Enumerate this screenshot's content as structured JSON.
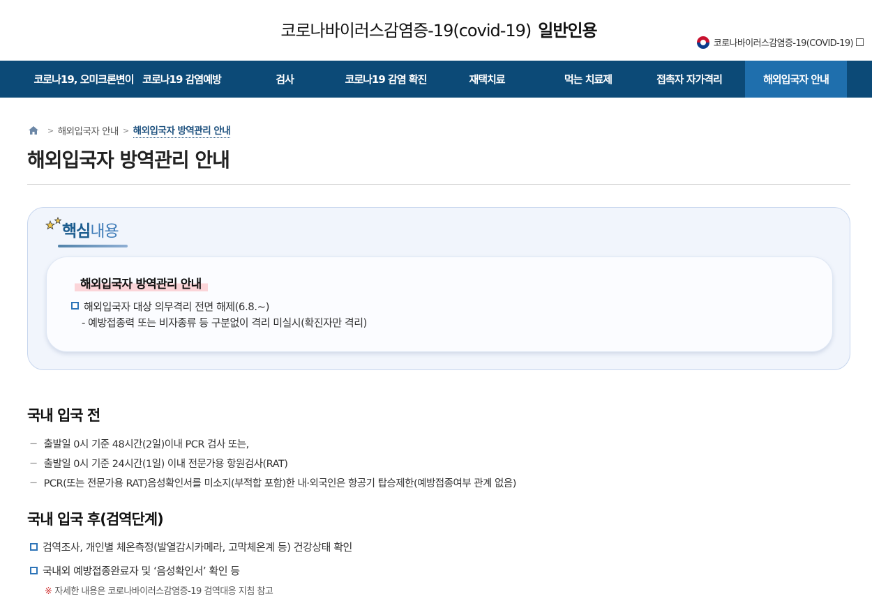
{
  "header": {
    "title_part1": "코로나바이러스감염증-19(covid-19)",
    "title_part2": "일반인용",
    "ministry_label": "코로나바이러스감염증-19(COVID-19)",
    "ministry_icon": "taegukgi-icon",
    "ext_icon": "external-link-icon"
  },
  "nav": {
    "items": [
      "코로나19, 오미크론변이",
      "코로나19 감염예방",
      "검사",
      "코로나19 감염 확진",
      "재택치료",
      "먹는 치료제",
      "접촉자 자가격리",
      "해외입국자 안내"
    ],
    "active_index": 7,
    "colors": {
      "bar": "#0c4a77",
      "active": "#1f6fad"
    }
  },
  "breadcrumb": {
    "home_icon": "home-icon",
    "items": [
      "해외입국자 안내",
      "해외입국자 방역관리 안내"
    ]
  },
  "page_title": "해외입국자 방역관리 안내",
  "key_box": {
    "label_bold": "핵심",
    "label_light": "내용",
    "title": "해외입국자 방역관리 안내",
    "line1": "해외입국자 대상 의무격리 전면 해제(6.8.~)",
    "line2": "- 예방접종력 또는 비자종류 등 구분없이 격리 미실시(확진자만 격리)"
  },
  "section1": {
    "title": "국내 입국 전",
    "items": [
      "출발일 0시 기준 48시간(2일)이내 PCR 검사 또는,",
      "출발일 0시 기준 24시간(1일) 이내 전문가용 항원검사(RAT)",
      "PCR(또는 전문가용 RAT)음성확인서를 미소지(부적합 포함)한 내·외국인은 항공기 탑승제한(예방접종여부 관계 없음)"
    ]
  },
  "section2": {
    "title": "국내 입국 후(검역단계)",
    "items": [
      "검역조사, 개인별 체온측정(발열감시카메라, 고막체온계 등) 건강상태 확인",
      "국내외 예방접종완료자 및 ‘음성확인서’ 확인 등"
    ],
    "note_mark": "※",
    "note": "자세한 내용은 코로나바이러스감염증-19 검역대응 지침 참고"
  }
}
